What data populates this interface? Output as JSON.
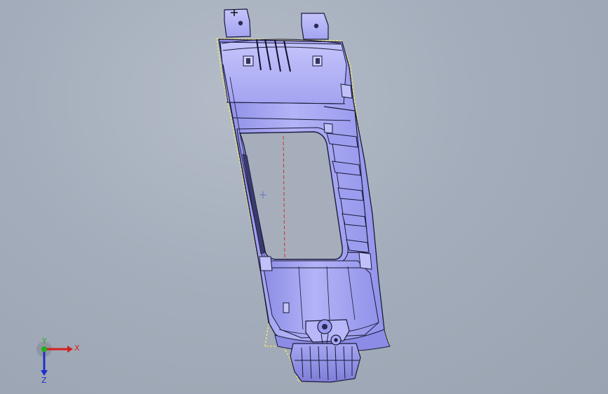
{
  "viewport": {
    "background_color": "#a7afbc",
    "model_color": "#a9a9f4",
    "edge_color": "#1a1a3a",
    "selection_color": "#e8e070"
  },
  "triad": {
    "x_label": "X",
    "y_label": "Y",
    "z_label": "Z",
    "x_color": "#d42020",
    "y_color": "#20b020",
    "z_color": "#2030c8"
  }
}
